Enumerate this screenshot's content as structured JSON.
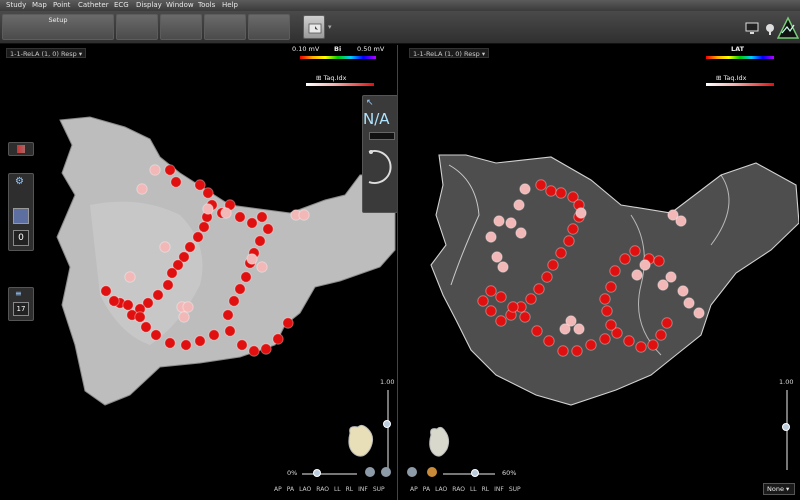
{
  "menu": [
    "Study",
    "Map",
    "Point",
    "Catheter",
    "ECG",
    "Display",
    "Window",
    "Tools",
    "Help"
  ],
  "toolbar": {
    "setup_label": "Setup"
  },
  "left_view": {
    "title": "1-1-ReLA (1, 0) Resp",
    "legend_min": "0.10 mV",
    "legend_title": "Bi",
    "legend_max": "0.50 mV",
    "tag_label": "Taq.Idx",
    "na_text": "N/A",
    "counter_zero": "0",
    "counter_17": "17",
    "scale_top": "1.00",
    "opacity_pct": "0%"
  },
  "right_view": {
    "title": "1-1-ReLA (1, 0) Resp",
    "legend_title": "LAT",
    "tag_label": "Taq.Idx",
    "scale_top": "1.00",
    "opacity_pct": "60%"
  },
  "orientations": [
    "AP",
    "PA",
    "LAO",
    "RAO",
    "LL",
    "RL",
    "INF",
    "SUP"
  ],
  "none_select": "None",
  "colors": {
    "tag_red": "#e01010",
    "tag_pink": "#f2b8b8",
    "shell_left": "#bdbdbd",
    "shell_right": "#5a5a5a"
  }
}
